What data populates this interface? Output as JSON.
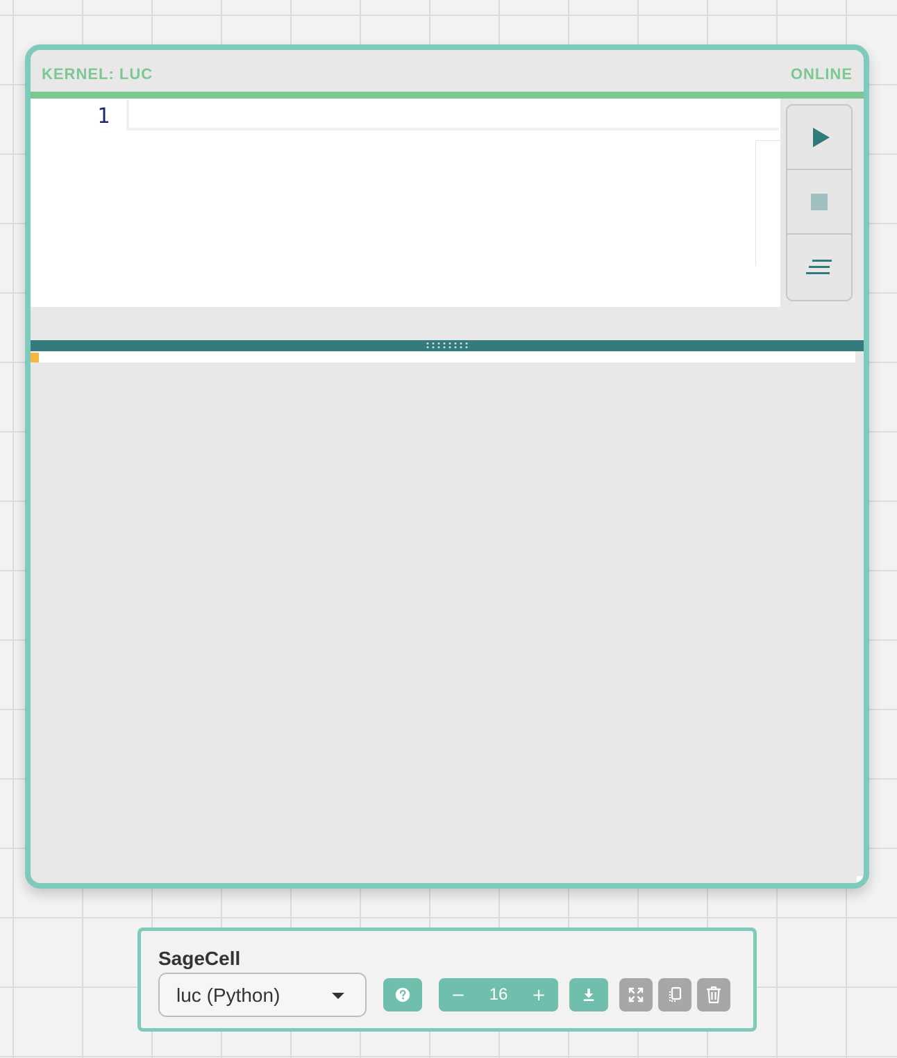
{
  "cell": {
    "kernel_label": "KERNEL: LUC",
    "status": "ONLINE",
    "editor": {
      "line_numbers": [
        "1"
      ]
    },
    "controls": {
      "run_icon": "play-icon",
      "stop_icon": "stop-icon",
      "format_icon": "align-lines-icon"
    }
  },
  "toolbar": {
    "title": "SageCell",
    "kernel_select_value": "luc (Python)",
    "help_icon": "question-circle-icon",
    "font_size_decrease": "−",
    "font_size": "16",
    "font_size_increase": "+",
    "download_icon": "download-icon",
    "fullscreen_icon": "expand-icon",
    "copy_icon": "copy-icon",
    "delete_icon": "trash-icon"
  },
  "colors": {
    "frame": "#7fcabb",
    "status_green": "#7cc890",
    "splitter": "#357b7b",
    "output_marker": "#f5b642",
    "button_teal": "#6fbfac",
    "button_grey": "#a7a7a7"
  }
}
